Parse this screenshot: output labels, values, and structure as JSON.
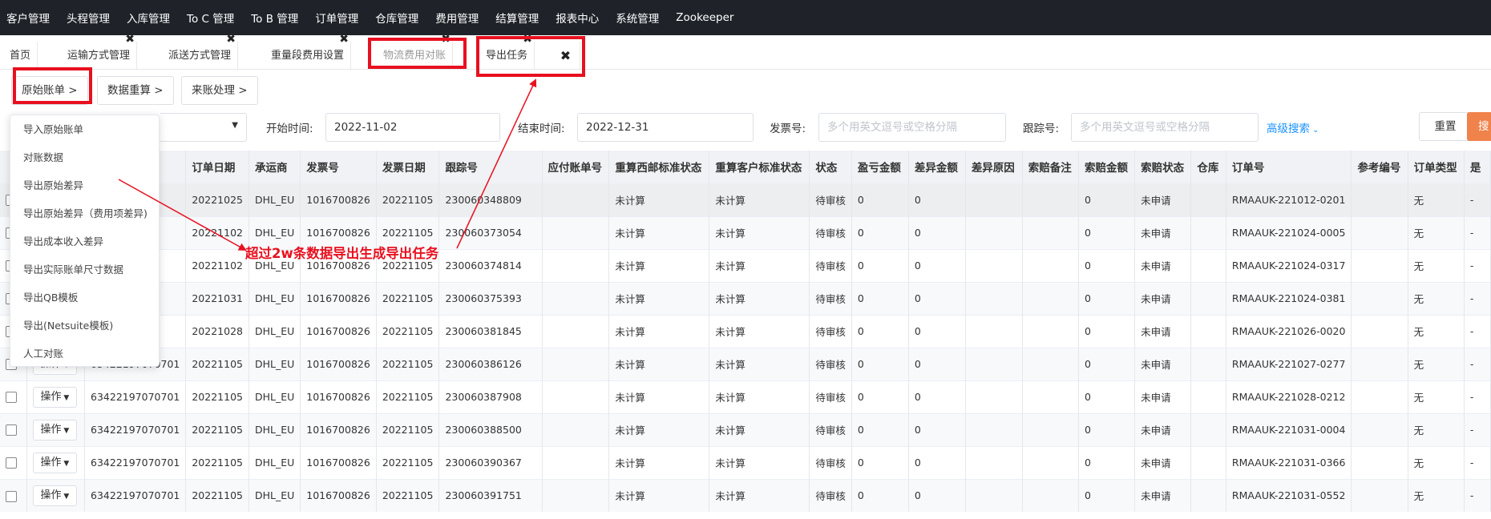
{
  "topnav": [
    "客户管理",
    "头程管理",
    "入库管理",
    "To C 管理",
    "To B 管理",
    "订单管理",
    "仓库管理",
    "费用管理",
    "结算管理",
    "报表中心",
    "系统管理",
    "Zookeeper"
  ],
  "tabs": {
    "home": "首页",
    "t1": "运输方式管理",
    "t2": "派送方式管理",
    "t3": "重量段费用设置",
    "t4": "物流费用对账",
    "t5": "导出任务",
    "close_symbol": "✖"
  },
  "breadcrumbs": [
    "原始账单 >",
    "数据重算 >",
    "来账处理 >"
  ],
  "filters": {
    "start_label": "开始时间:",
    "start_value": "2022-11-02",
    "end_label": "结束时间:",
    "end_value": "2022-12-31",
    "invoice_label": "发票号:",
    "invoice_placeholder": "多个用英文逗号或空格分隔",
    "tracking_label": "跟踪号:",
    "tracking_placeholder": "多个用英文逗号或空格分隔",
    "advanced": "高级搜索",
    "reset": "重置",
    "search": "搜"
  },
  "dropdown_menu": [
    "导入原始账单",
    "对账数据",
    "导出原始差异",
    "导出原始差异（费用项差异)",
    "导出成本收入差异",
    "导出实际账单尺寸数据",
    "导出QB模板",
    "导出(Netsuite模板)",
    "人工对账"
  ],
  "annotation": "超过2w条数据导出生成导出任务",
  "table": {
    "headers": [
      "订单日期",
      "承运商",
      "发票号",
      "发票日期",
      "跟踪号",
      "应付账单号",
      "重算西邮标准状态",
      "重算客户标准状态",
      "状态",
      "盈亏金额",
      "差异金额",
      "差异原因",
      "索赔备注",
      "索赔金额",
      "索赔状态",
      "仓库",
      "订单号",
      "参考编号",
      "订单类型",
      "是"
    ],
    "op_label": "操作",
    "rows": [
      {
        "id": "...701",
        "date": "20221025",
        "carrier": "DHL_EU",
        "inv": "1016700826",
        "invdate": "20221105",
        "track": "230060348809",
        "s1": "未计算",
        "s2": "未计算",
        "st": "待审核",
        "pl": "0",
        "diff": "0",
        "claim": "0",
        "cst": "未申请",
        "order": "RMAAUK-221012-0201",
        "type": "无",
        "last": "-"
      },
      {
        "id": "...701",
        "date": "20221102",
        "carrier": "DHL_EU",
        "inv": "1016700826",
        "invdate": "20221105",
        "track": "230060373054",
        "s1": "未计算",
        "s2": "未计算",
        "st": "待审核",
        "pl": "0",
        "diff": "0",
        "claim": "0",
        "cst": "未申请",
        "order": "RMAAUK-221024-0005",
        "type": "无",
        "last": "-"
      },
      {
        "id": "...701",
        "date": "20221102",
        "carrier": "DHL_EU",
        "inv": "1016700826",
        "invdate": "20221105",
        "track": "230060374814",
        "s1": "未计算",
        "s2": "未计算",
        "st": "待审核",
        "pl": "0",
        "diff": "0",
        "claim": "0",
        "cst": "未申请",
        "order": "RMAAUK-221024-0317",
        "type": "无",
        "last": "-"
      },
      {
        "id": "...701",
        "date": "20221031",
        "carrier": "DHL_EU",
        "inv": "1016700826",
        "invdate": "20221105",
        "track": "230060375393",
        "s1": "未计算",
        "s2": "未计算",
        "st": "待审核",
        "pl": "0",
        "diff": "0",
        "claim": "0",
        "cst": "未申请",
        "order": "RMAAUK-221024-0381",
        "type": "无",
        "last": "-"
      },
      {
        "id": "...701",
        "date": "20221028",
        "carrier": "DHL_EU",
        "inv": "1016700826",
        "invdate": "20221105",
        "track": "230060381845",
        "s1": "未计算",
        "s2": "未计算",
        "st": "待审核",
        "pl": "0",
        "diff": "0",
        "claim": "0",
        "cst": "未申请",
        "order": "RMAAUK-221026-0020",
        "type": "无",
        "last": "-"
      },
      {
        "id": "63422197070701",
        "date": "20221105",
        "carrier": "DHL_EU",
        "inv": "1016700826",
        "invdate": "20221105",
        "track": "230060386126",
        "s1": "未计算",
        "s2": "未计算",
        "st": "待审核",
        "pl": "0",
        "diff": "0",
        "claim": "0",
        "cst": "未申请",
        "order": "RMAAUK-221027-0277",
        "type": "无",
        "last": "-"
      },
      {
        "id": "63422197070701",
        "date": "20221105",
        "carrier": "DHL_EU",
        "inv": "1016700826",
        "invdate": "20221105",
        "track": "230060387908",
        "s1": "未计算",
        "s2": "未计算",
        "st": "待审核",
        "pl": "0",
        "diff": "0",
        "claim": "0",
        "cst": "未申请",
        "order": "RMAAUK-221028-0212",
        "type": "无",
        "last": "-"
      },
      {
        "id": "63422197070701",
        "date": "20221105",
        "carrier": "DHL_EU",
        "inv": "1016700826",
        "invdate": "20221105",
        "track": "230060388500",
        "s1": "未计算",
        "s2": "未计算",
        "st": "待审核",
        "pl": "0",
        "diff": "0",
        "claim": "0",
        "cst": "未申请",
        "order": "RMAAUK-221031-0004",
        "type": "无",
        "last": "-"
      },
      {
        "id": "63422197070701",
        "date": "20221105",
        "carrier": "DHL_EU",
        "inv": "1016700826",
        "invdate": "20221105",
        "track": "230060390367",
        "s1": "未计算",
        "s2": "未计算",
        "st": "待审核",
        "pl": "0",
        "diff": "0",
        "claim": "0",
        "cst": "未申请",
        "order": "RMAAUK-221031-0366",
        "type": "无",
        "last": "-"
      },
      {
        "id": "63422197070701",
        "date": "20221105",
        "carrier": "DHL_EU",
        "inv": "1016700826",
        "invdate": "20221105",
        "track": "230060391751",
        "s1": "未计算",
        "s2": "未计算",
        "st": "待审核",
        "pl": "0",
        "diff": "0",
        "claim": "0",
        "cst": "未申请",
        "order": "RMAAUK-221031-0552",
        "type": "无",
        "last": "-"
      }
    ]
  }
}
